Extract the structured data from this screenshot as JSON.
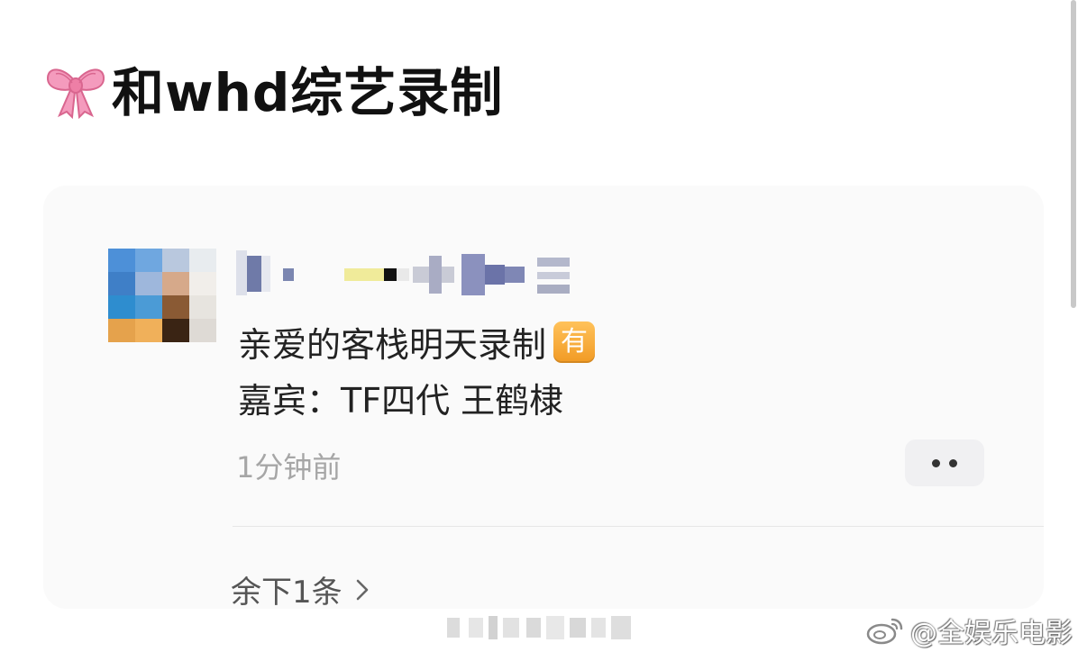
{
  "headline": {
    "icon": "bow-ribbon-icon",
    "text": "和whd综艺录制"
  },
  "message": {
    "avatar": "blurred-avatar",
    "username": "blurred-username",
    "line1": "亲爱的客栈明天录制",
    "badge": "有",
    "line2": "嘉宾：TF四代 王鹤棣",
    "time": "1分钟前",
    "more_icon": "more-dots-icon"
  },
  "footer": {
    "remaining": "余下1条",
    "chevron_icon": "chevron-right-icon"
  },
  "watermark": {
    "icon": "weibo-logo-icon",
    "text": "@全娱乐电影"
  },
  "colors": {
    "badge": "#f5a623",
    "headline": "#111111",
    "muted": "#a6a6a6"
  }
}
